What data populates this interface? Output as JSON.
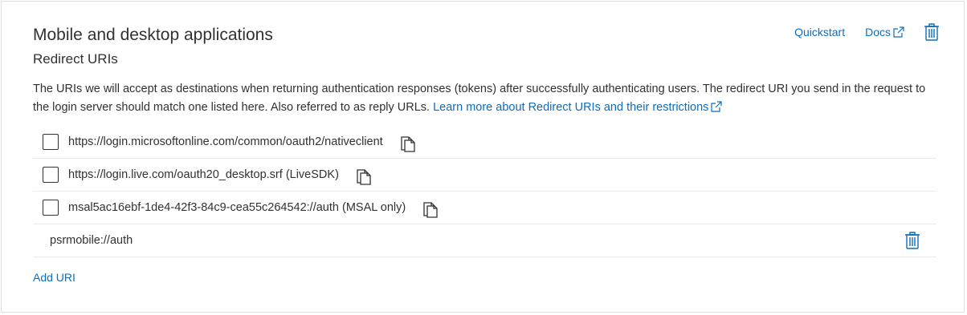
{
  "section": {
    "title": "Mobile and desktop applications",
    "subtitle": "Redirect URIs",
    "quickstart_label": "Quickstart",
    "docs_label": "Docs"
  },
  "description": {
    "text": "The URIs we will accept as destinations when returning authentication responses (tokens) after successfully authenticating users. The redirect URI you send in the request to the login server should match one listed here. Also referred to as reply URLs. ",
    "link_text": "Learn more about Redirect URIs and their restrictions"
  },
  "uris": [
    {
      "value": "https://login.microsoftonline.com/common/oauth2/nativeclient",
      "checked": false
    },
    {
      "value": "https://login.live.com/oauth20_desktop.srf (LiveSDK)",
      "checked": false
    },
    {
      "value": "msal5ac16ebf-1de4-42f3-84c9-cea55c264542://auth (MSAL only)",
      "checked": false
    }
  ],
  "custom_uri": {
    "value": "psrmobile://auth"
  },
  "add_uri_label": "Add URI",
  "colors": {
    "accent": "#0f6cbd",
    "text": "#323130",
    "border": "#e1dfdd"
  },
  "icons": [
    "external-link-icon",
    "trash-icon",
    "copy-icon"
  ]
}
